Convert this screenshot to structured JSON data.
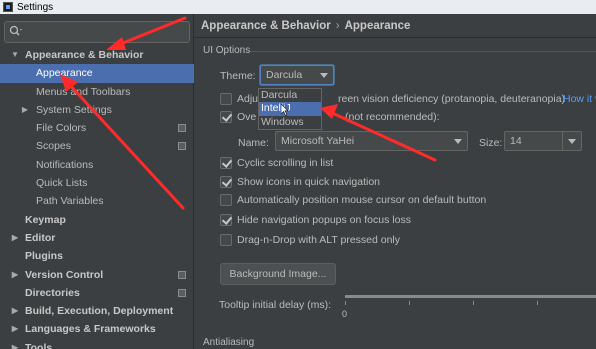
{
  "window": {
    "title": "Settings"
  },
  "sidebar": {
    "search": {
      "value": "",
      "placeholder": ""
    },
    "items": [
      {
        "label": "Appearance & Behavior",
        "expanded": true,
        "bold": true
      },
      {
        "label": "Appearance",
        "selected": true
      },
      {
        "label": "Menus and Toolbars"
      },
      {
        "label": "System Settings",
        "collapsed": true
      },
      {
        "label": "File Colors"
      },
      {
        "label": "Scopes"
      },
      {
        "label": "Notifications"
      },
      {
        "label": "Quick Lists"
      },
      {
        "label": "Path Variables"
      },
      {
        "label": "Keymap",
        "bold": true
      },
      {
        "label": "Editor",
        "bold": true
      },
      {
        "label": "Plugins",
        "bold": true
      },
      {
        "label": "Version Control",
        "bold": true
      },
      {
        "label": "Directories",
        "bold": true
      },
      {
        "label": "Build, Execution, Deployment",
        "bold": true
      },
      {
        "label": "Languages & Frameworks",
        "bold": true
      },
      {
        "label": "Tools",
        "bold": true
      }
    ]
  },
  "main": {
    "breadcrumb": {
      "parent": "Appearance & Behavior",
      "separator": "›",
      "current": "Appearance"
    },
    "section_ui_options": "UI Options",
    "theme_label": "Theme:",
    "theme_value": "Darcula",
    "theme_options": [
      "Darcula",
      "IntelliJ",
      "Windows"
    ],
    "theme_highlighted": "IntelliJ",
    "adjust_colors_prefix": "Adju",
    "adjust_colors_suffix": "reen vision deficiency (protanopia, deuteranopia)",
    "adjust_colors_link": "How it w",
    "override_fonts_prefix": "Ove",
    "override_fonts_suffix": "(not recommended):",
    "font_name_label": "Name:",
    "font_name_value": "Microsoft YaHei",
    "font_size_label": "Size:",
    "font_size_value": "14",
    "options": [
      {
        "label": "Cyclic scrolling in list",
        "checked": true
      },
      {
        "label": "Show icons in quick navigation",
        "checked": true
      },
      {
        "label": "Automatically position mouse cursor on default button",
        "checked": false
      },
      {
        "label": "Hide navigation popups on focus loss",
        "checked": true
      },
      {
        "label": "Drag-n-Drop with ALT pressed only",
        "checked": false
      }
    ],
    "background_image_button": "Background Image...",
    "tooltip_delay_label": "Tooltip initial delay (ms):",
    "tooltip_delay_min": "0",
    "tooltip_delay_value": 0,
    "section_antialiasing": "Antialiasing"
  },
  "colors": {
    "background": "#3c3f41",
    "selection": "#4b6eaf",
    "annotation_arrow": "#ff2a2a",
    "link": "#589df6"
  }
}
